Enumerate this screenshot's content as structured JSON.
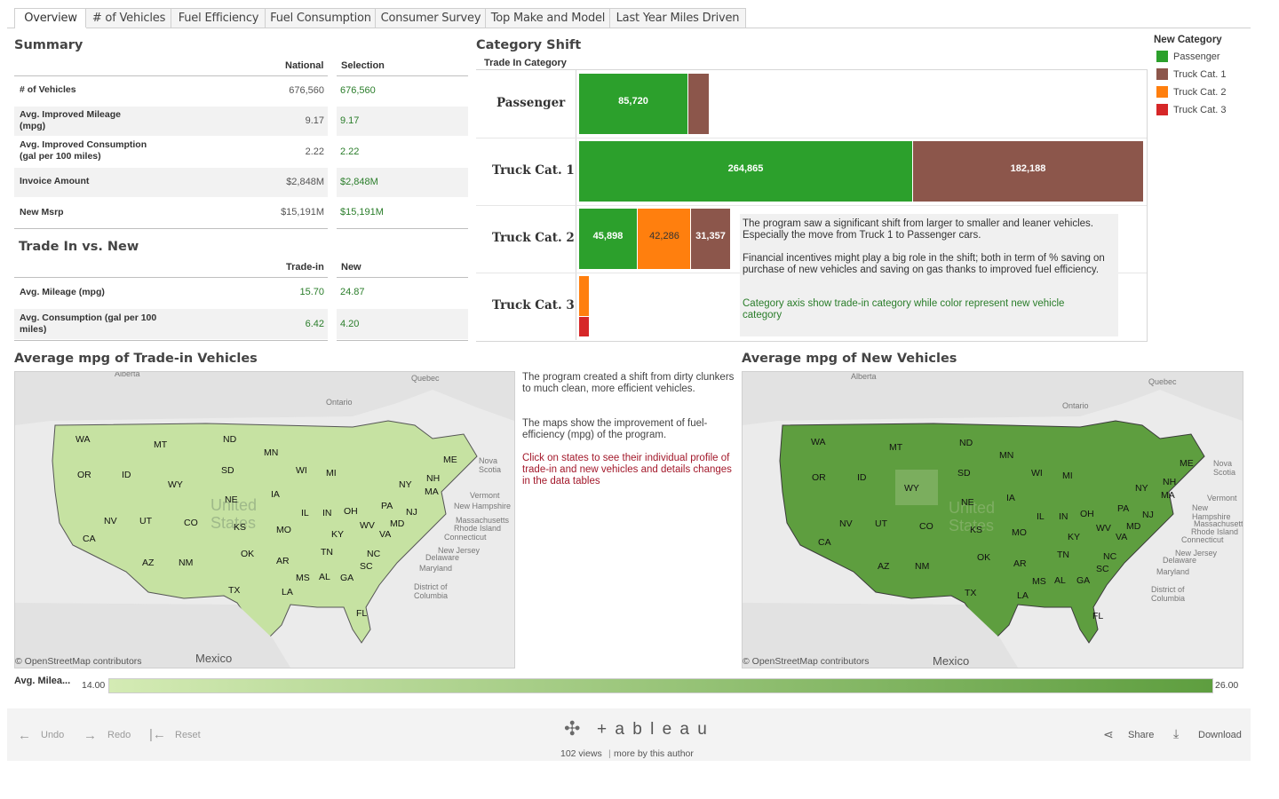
{
  "tabs": [
    "Overview",
    "# of Vehicles",
    "Fuel Efficiency",
    "Fuel Consumption",
    "Consumer Survey",
    "Top Make and Model",
    "Last Year Miles Driven"
  ],
  "summary": {
    "title": "Summary",
    "col_national": "National",
    "col_selection": "Selection",
    "rows": [
      {
        "label": "# of Vehicles",
        "national": "676,560",
        "selection": "676,560"
      },
      {
        "label": "Avg. Improved Mileage\n(mpg)",
        "national": "9.17",
        "selection": "9.17"
      },
      {
        "label": "Avg. Improved Consumption\n(gal per 100 miles)",
        "national": "2.22",
        "selection": "2.22"
      },
      {
        "label": "Invoice Amount",
        "national": "$2,848M",
        "selection": "$2,848M"
      },
      {
        "label": "New Msrp",
        "national": "$15,191M",
        "selection": "$15,191M"
      }
    ]
  },
  "trade": {
    "title": "Trade In vs. New",
    "col_tradein": "Trade-in",
    "col_new": "New",
    "rows": [
      {
        "label": "Avg. Mileage (mpg)",
        "tradein": "15.70",
        "new": "24.87"
      },
      {
        "label": "Avg. Consumption (gal per 100\nmiles)",
        "tradein": "6.42",
        "new": "4.20"
      }
    ]
  },
  "category_shift": {
    "title": "Category Shift",
    "axis_title": "Trade In Category",
    "categories": [
      "Passenger",
      "Truck Cat. 1",
      "Truck Cat. 2",
      "Truck Cat. 3"
    ],
    "bar_labels": {
      "passenger_passenger": "85,720",
      "truck1_passenger": "264,865",
      "truck1_truck1": "182,188",
      "truck2_passenger": "45,898",
      "truck2_truck2": "42,286",
      "truck2_truck1": "31,357"
    },
    "note_p1": "The program saw a significant shift from larger to smaller and leaner vehicles. Especially the move from Truck 1 to Passenger cars.",
    "note_p2": "Financial incentives might play a big role in the shift; both in term of % saving on purchase of new vehicles and saving on gas thanks to improved fuel efficiency.",
    "note_p3": "Category axis show trade-in category while color represent new vehicle category"
  },
  "chart_data": {
    "type": "bar",
    "title": "Category Shift",
    "xlabel": "",
    "ylabel": "Trade In Category",
    "categories": [
      "Passenger",
      "Truck Cat. 1",
      "Truck Cat. 2",
      "Truck Cat. 3"
    ],
    "series": [
      {
        "name": "Passenger",
        "values": [
          85720,
          264865,
          45898,
          0
        ]
      },
      {
        "name": "Truck Cat. 1",
        "values": [
          15000,
          182188,
          31357,
          0
        ]
      },
      {
        "name": "Truck Cat. 2",
        "values": [
          0,
          0,
          42286,
          9000
        ]
      },
      {
        "name": "Truck Cat. 3",
        "values": [
          0,
          0,
          0,
          4000
        ]
      }
    ],
    "stacked": true,
    "orientation": "horizontal",
    "legend_position": "top-right"
  },
  "legend": {
    "title": "New Category",
    "items": [
      {
        "label": "Passenger",
        "color": "#2ca02c"
      },
      {
        "label": "Truck Cat. 1",
        "color": "#8c564b"
      },
      {
        "label": "Truck Cat. 2",
        "color": "#ff7f0e"
      },
      {
        "label": "Truck Cat. 3",
        "color": "#d62728"
      }
    ]
  },
  "maps": {
    "trade_title": "Average mpg of Trade-in Vehicles",
    "new_title": "Average mpg of New Vehicles",
    "attribution": "© OpenStreetMap contributors",
    "country_mexico": "Mexico",
    "state_labels": [
      "WA",
      "OR",
      "CA",
      "ID",
      "NV",
      "MT",
      "WY",
      "UT",
      "AZ",
      "CO",
      "NM",
      "ND",
      "SD",
      "NE",
      "KS",
      "OK",
      "TX",
      "MN",
      "IA",
      "MO",
      "AR",
      "LA",
      "WI",
      "IL",
      "MS",
      "MI",
      "IN",
      "KY",
      "TN",
      "AL",
      "OH",
      "WV",
      "GA",
      "FL",
      "SC",
      "NC",
      "VA",
      "PA",
      "NY",
      "ME",
      "NH",
      "MA",
      "NJ",
      "MD"
    ],
    "place_labels": [
      "Alberta",
      "Ontario",
      "Quebec",
      "Vermont",
      "New Hampshire",
      "Massachusetts",
      "Rhode Island",
      "Connecticut",
      "New Jersey",
      "Delaware",
      "Maryland",
      "District of Columbia",
      "Nova Scotia",
      "United States"
    ],
    "trade_color": "#c6e2a2",
    "new_color": "#5e9e3f"
  },
  "map_note": {
    "p1": "The program created a shift from dirty clunkers to much clean, more efficient vehicles.",
    "p2": "The maps show the improvement of fuel-efficiency (mpg) of the program.",
    "p3": "Click on states to see their individual profile of trade-in and new vehicles and details changes in the data tables"
  },
  "color_legend": {
    "label": "Avg. Milea...",
    "min": "14.00",
    "max": "26.00",
    "color_min": "#d4ebb4",
    "color_max": "#5e9e3f"
  },
  "footer": {
    "undo": "Undo",
    "redo": "Redo",
    "reset": "Reset",
    "brand": "+ a b l e a u",
    "views": "102 views",
    "more": "more by this author",
    "share": "Share",
    "download": "Download"
  }
}
